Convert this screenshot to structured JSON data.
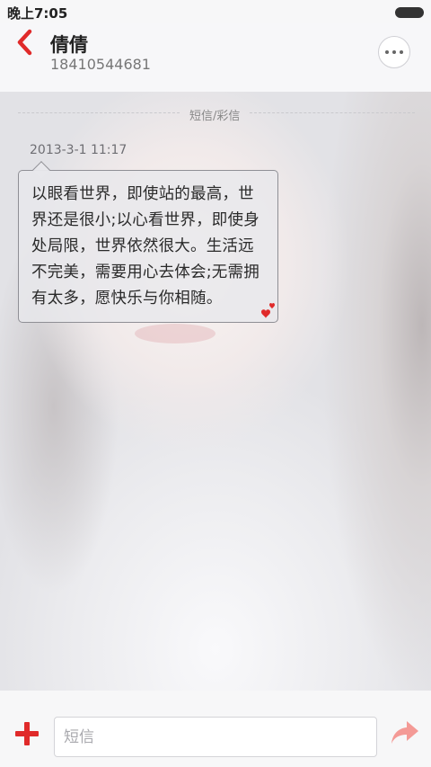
{
  "status_bar": {
    "time": "晚上7:05",
    "battery_icon": "battery-icon"
  },
  "header": {
    "back_icon": "back-arrow-icon",
    "contact_name": "倩倩",
    "contact_number": "18410544681",
    "more_icon": "more-dots-icon"
  },
  "conversation": {
    "divider_label": "短信/彩信",
    "messages": [
      {
        "timestamp": "2013-3-1 11:17",
        "text": "以眼看世界，即使站的最高，世界还是很小;以心看世界，即使身处局限，世界依然很大。生活远不完美，需要用心去体会;无需拥有太多，愿快乐与你相随。",
        "decoration_icon": "hearts-icon"
      }
    ]
  },
  "input_bar": {
    "add_icon": "plus-icon",
    "placeholder": "短信",
    "value": "",
    "send_icon": "send-icon"
  },
  "colors": {
    "accent_red": "#e02a2a",
    "send_pink": "#f49a96"
  }
}
